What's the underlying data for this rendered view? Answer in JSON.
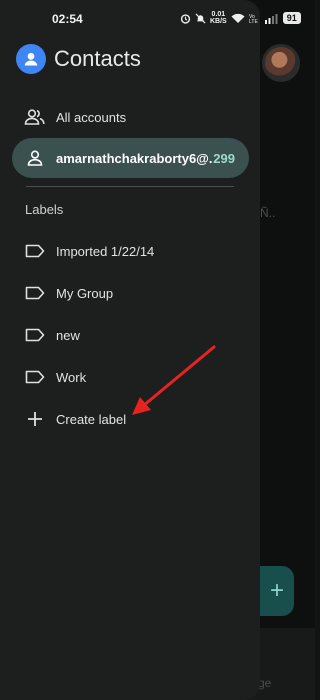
{
  "status_bar": {
    "time": "02:54",
    "speed_value": "0.01",
    "speed_unit": "KB/S",
    "battery": "91"
  },
  "drawer": {
    "app_title": "Contacts",
    "all_accounts_label": "All accounts",
    "account": {
      "label": "amarnathchakraborty6@...",
      "count": "299"
    },
    "labels_heading": "Labels",
    "labels": [
      "Imported 1/22/14",
      "My Group",
      "new",
      "Work"
    ],
    "create_label": "Create label"
  },
  "background": {
    "ghost_text": "Ñ..",
    "bottom_text": "ge"
  },
  "colors": {
    "drawer_bg": "#1c1f1e",
    "selected_bg": "#3b5150",
    "accent_count": "#9fd9cf",
    "logo_blue": "#3f86f4",
    "annotation_arrow": "#e52421"
  }
}
